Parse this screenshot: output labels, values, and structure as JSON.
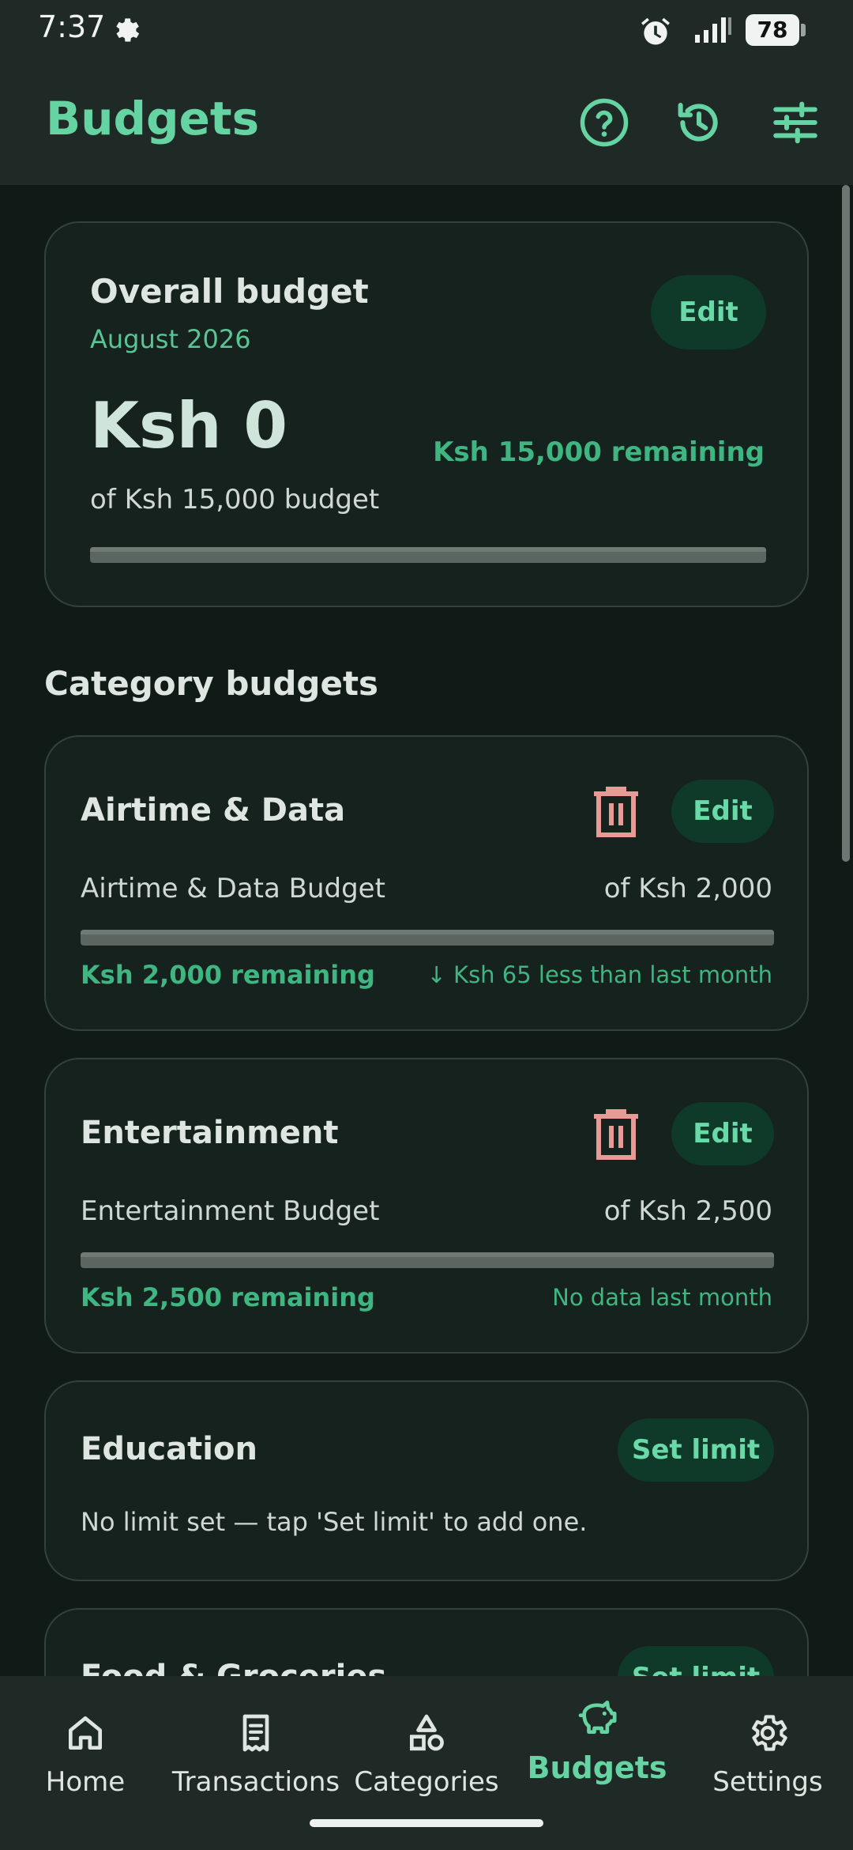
{
  "status_bar": {
    "time": "7:37",
    "battery": "78"
  },
  "app_bar": {
    "title": "Budgets",
    "actions": [
      "help-icon",
      "history-icon",
      "tune-icon"
    ]
  },
  "overall": {
    "title": "Overall budget",
    "period": "August 2026",
    "edit_label": "Edit",
    "spent": "Ksh 0",
    "of_budget": "of Ksh 15,000 budget",
    "remaining": "Ksh 15,000 remaining",
    "progress_fraction": 0
  },
  "section_title": "Category budgets",
  "categories": [
    {
      "name": "Airtime & Data",
      "edit_label": "Edit",
      "budget_label": "Airtime & Data Budget",
      "of_amount": "of Ksh 2,000",
      "remaining": "Ksh 2,000 remaining",
      "comparison": "↓ Ksh 65 less than last month",
      "progress_fraction": 0
    },
    {
      "name": "Entertainment",
      "edit_label": "Edit",
      "budget_label": "Entertainment Budget",
      "of_amount": "of Ksh 2,500",
      "remaining": "Ksh 2,500 remaining",
      "comparison": "No data last month",
      "progress_fraction": 0
    },
    {
      "name": "Education",
      "set_limit_label": "Set limit",
      "note": "No limit set — tap 'Set limit' to add one."
    },
    {
      "name": "Food & Groceries",
      "set_limit_label": "Set limit"
    }
  ],
  "bottom_nav": [
    {
      "label": "Home",
      "icon": "home-icon",
      "active": false
    },
    {
      "label": "Transactions",
      "icon": "receipt-icon",
      "active": false
    },
    {
      "label": "Categories",
      "icon": "shapes-icon",
      "active": false
    },
    {
      "label": "Budgets",
      "icon": "piggy-bank-icon",
      "active": true
    },
    {
      "label": "Settings",
      "icon": "gear-icon",
      "active": false
    }
  ],
  "colors": {
    "accent": "#65d3a2",
    "remaining_green": "#3fb682",
    "tonal_button": "#0f3a2a",
    "delete": "#e89a96",
    "background": "#101b17",
    "card": "#15221d"
  }
}
